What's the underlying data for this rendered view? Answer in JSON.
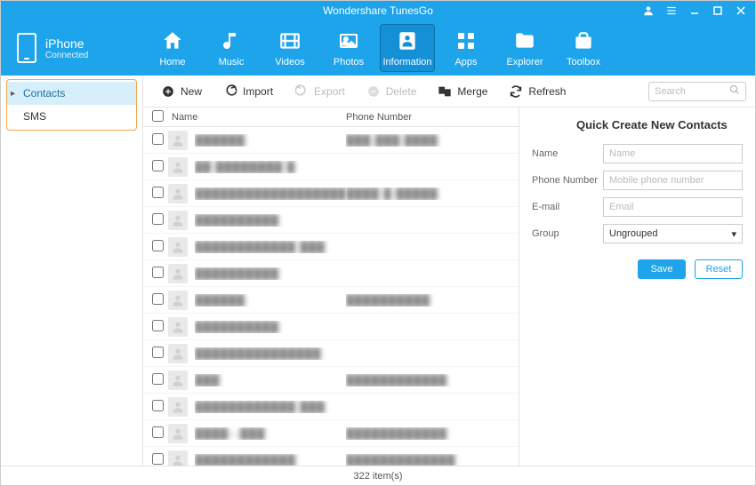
{
  "app": {
    "title": "Wondershare TunesGo"
  },
  "device": {
    "name": "iPhone",
    "status": "Connected"
  },
  "nav": {
    "home": "Home",
    "music": "Music",
    "videos": "Videos",
    "photos": "Photos",
    "information": "Information",
    "apps": "Apps",
    "explorer": "Explorer",
    "toolbox": "Toolbox"
  },
  "sidebar": {
    "contacts": "Contacts",
    "sms": "SMS"
  },
  "toolbar": {
    "new": "New",
    "import": "Import",
    "export": "Export",
    "delete": "Delete",
    "merge": "Merge",
    "refresh": "Refresh",
    "search_placeholder": "Search"
  },
  "list": {
    "col_name": "Name",
    "col_phone": "Phone Number",
    "rows": [
      {
        "name": "██████",
        "phone": "███ ███ ████"
      },
      {
        "name": "██ ████████ █",
        "phone": ""
      },
      {
        "name": "██████████████████",
        "phone": "████ █ █████"
      },
      {
        "name": "██████████",
        "phone": ""
      },
      {
        "name": "████████████ ███",
        "phone": ""
      },
      {
        "name": "██████████",
        "phone": ""
      },
      {
        "name": "██████",
        "phone": "██████████"
      },
      {
        "name": "██████████",
        "phone": ""
      },
      {
        "name": "███████████████",
        "phone": ""
      },
      {
        "name": "███",
        "phone": "████████████"
      },
      {
        "name": "████████████ ███",
        "phone": ""
      },
      {
        "name": "████—███",
        "phone": "████████████"
      },
      {
        "name": "████████████",
        "phone": "█████████████"
      }
    ]
  },
  "form": {
    "title": "Quick Create New Contacts",
    "name_label": "Name",
    "name_ph": "Name",
    "phone_label": "Phone Number",
    "phone_ph": "Mobile phone number",
    "email_label": "E-mail",
    "email_ph": "Email",
    "group_label": "Group",
    "group_value": "Ungrouped",
    "save": "Save",
    "reset": "Reset"
  },
  "status": {
    "count": "322 item(s)"
  }
}
